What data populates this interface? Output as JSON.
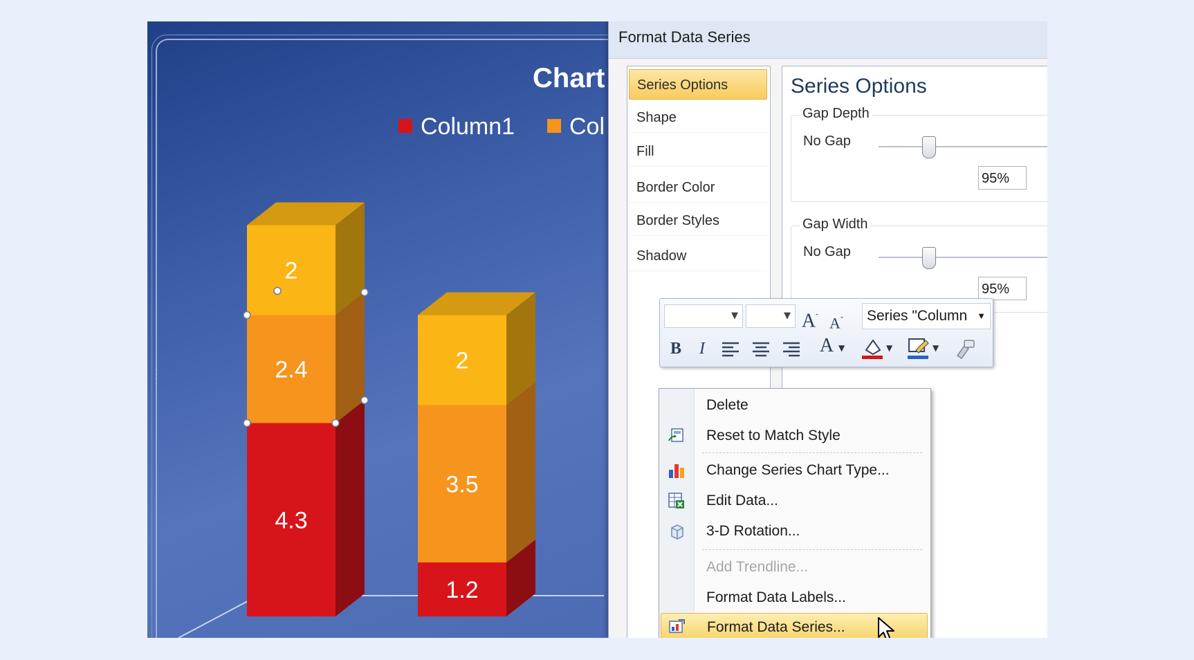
{
  "chart": {
    "title": "Chart",
    "legend": [
      {
        "label": "Column1",
        "color": "#d8141b"
      },
      {
        "label": "Col",
        "color": "#f7941d"
      }
    ]
  },
  "chart_data": {
    "type": "bar",
    "stacked": true,
    "three_d": true,
    "title": "Chart",
    "categories": [
      "",
      ""
    ],
    "series": [
      {
        "name": "Column1",
        "values": [
          4.3,
          1.2
        ],
        "color": "#d8141b"
      },
      {
        "values": [
          2.4,
          3.5
        ],
        "color": "#f7941d"
      },
      {
        "values": [
          2,
          2
        ],
        "color": "#fbb514"
      }
    ],
    "data_labels": [
      [
        "4.3",
        "2.4",
        "2"
      ],
      [
        "1.2",
        "3.5",
        "2"
      ]
    ],
    "grid": false
  },
  "dialog": {
    "title": "Format Data Series",
    "nav_items": [
      "Series Options",
      "Shape",
      "Fill",
      "Border Color",
      "Border Styles",
      "Shadow"
    ],
    "selected_nav": "Series Options",
    "options_heading": "Series Options",
    "gap_depth": {
      "title": "Gap Depth",
      "label": "No Gap",
      "value": "95%",
      "level": 0.24
    },
    "gap_width": {
      "title": "Gap Width",
      "label": "No Gap",
      "value": "95%",
      "level": 0.24
    }
  },
  "mini_toolbar": {
    "series_select": "Series \"Column",
    "grow_font": "A",
    "shrink_font": "A",
    "bold": "B",
    "italic": "I",
    "font_color": "A",
    "icons": [
      "font-combo",
      "size-combo",
      "grow-font-icon",
      "shrink-font-icon",
      "bold-icon",
      "italic-icon",
      "align-left-icon",
      "align-center-icon",
      "align-right-icon",
      "font-color-icon",
      "shape-fill-icon",
      "shape-outline-icon",
      "format-painter-icon"
    ]
  },
  "context_menu": {
    "items": [
      {
        "label": "Delete",
        "icon": null,
        "disabled": false
      },
      {
        "label": "Reset to Match Style",
        "icon": "reset-style-icon",
        "disabled": false
      },
      {
        "label": "Change Series Chart Type...",
        "icon": "chart-type-icon",
        "disabled": false
      },
      {
        "label": "Edit Data...",
        "icon": "edit-data-icon",
        "disabled": false
      },
      {
        "label": "3-D Rotation...",
        "icon": "rotation-icon",
        "disabled": false
      },
      {
        "label": "Add Trendline...",
        "icon": null,
        "disabled": true
      },
      {
        "label": "Format Data Labels...",
        "icon": null,
        "disabled": false
      },
      {
        "label": "Format Data Series...",
        "icon": "format-series-icon",
        "disabled": false,
        "highlighted": true
      }
    ]
  },
  "colors": {
    "chart_bg": "#4262ad",
    "selection_yellow": "#f9cb5d",
    "red_series": "#d8141b",
    "orange_series": "#f7941d",
    "yellow_series": "#fbb514"
  }
}
